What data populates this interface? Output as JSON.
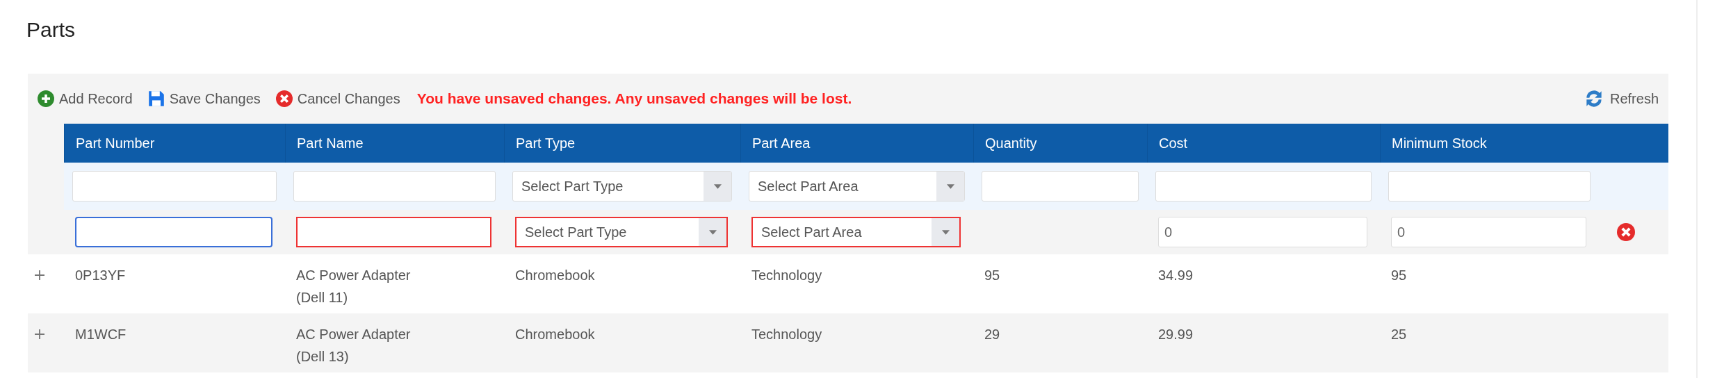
{
  "page_title": "Parts",
  "toolbar": {
    "buttons": [
      {
        "label": "Add Record",
        "kind": "add"
      },
      {
        "label": "Save Changes",
        "kind": "save"
      },
      {
        "label": "Cancel Changes",
        "kind": "cancel"
      }
    ],
    "warning": "You have unsaved changes. Any unsaved changes will be lost.",
    "refresh": "Refresh"
  },
  "table": {
    "columns": [
      "Part Number",
      "Part Name",
      "Part Type",
      "Part Area",
      "Quantity",
      "Cost",
      "Minimum Stock"
    ],
    "filters": [
      {
        "kind": "text"
      },
      {
        "kind": "text"
      },
      {
        "kind": "select",
        "placeholder": "Select Part Type"
      },
      {
        "kind": "select",
        "placeholder": "Select Part Area"
      },
      {
        "kind": "text"
      },
      {
        "kind": "text"
      },
      {
        "kind": "text"
      }
    ],
    "edit_row": [
      {
        "kind": "text",
        "focused": true,
        "invalid": false
      },
      {
        "kind": "text",
        "focused": false,
        "invalid": true
      },
      {
        "kind": "select",
        "placeholder": "Select Part Type",
        "focused": false,
        "invalid": true
      },
      {
        "kind": "select",
        "placeholder": "Select Part Area",
        "focused": false,
        "invalid": true
      },
      {
        "kind": "none"
      },
      {
        "kind": "text",
        "value": "0",
        "focused": false,
        "invalid": false
      },
      {
        "kind": "text",
        "value": "0",
        "focused": false,
        "invalid": false
      }
    ],
    "rows": [
      {
        "cells": [
          "0P13YF",
          "AC Power Adapter (Dell 11)",
          "Chromebook",
          "Technology",
          "95",
          "34.99",
          "95"
        ]
      },
      {
        "cells": [
          "M1WCF",
          "AC Power Adapter (Dell 13)",
          "Chromebook",
          "Technology",
          "29",
          "29.99",
          "25"
        ]
      }
    ]
  }
}
